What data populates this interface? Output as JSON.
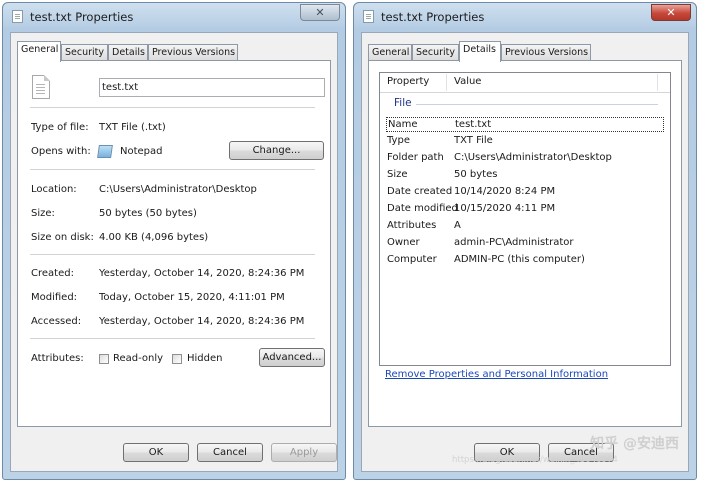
{
  "left": {
    "title": "test.txt Properties",
    "tabs": [
      "General",
      "Security",
      "Details",
      "Previous Versions"
    ],
    "file_name": "test.txt",
    "type_label": "Type of file:",
    "type_value": "TXT File (.txt)",
    "opens_label": "Opens with:",
    "opens_value": "Notepad",
    "change_button": "Change...",
    "location_label": "Location:",
    "location_value": "C:\\Users\\Administrator\\Desktop",
    "size_label": "Size:",
    "size_value": "50 bytes (50 bytes)",
    "size_disk_label": "Size on disk:",
    "size_disk_value": "4.00 KB (4,096 bytes)",
    "created_label": "Created:",
    "created_value": "Yesterday, October 14, 2020, 8:24:36 PM",
    "modified_label": "Modified:",
    "modified_value": "Today, October 15, 2020, 4:11:01 PM",
    "accessed_label": "Accessed:",
    "accessed_value": "Yesterday, October 14, 2020, 8:24:36 PM",
    "attributes_label": "Attributes:",
    "readonly_label": "Read-only",
    "hidden_label": "Hidden",
    "advanced_button": "Advanced...",
    "ok_button": "OK",
    "cancel_button": "Cancel",
    "apply_button": "Apply"
  },
  "right": {
    "title": "test.txt Properties",
    "tabs": [
      "General",
      "Security",
      "Details",
      "Previous Versions"
    ],
    "col_property": "Property",
    "col_value": "Value",
    "group": "File",
    "rows": [
      {
        "p": "Name",
        "v": "test.txt"
      },
      {
        "p": "Type",
        "v": "TXT File"
      },
      {
        "p": "Folder path",
        "v": "C:\\Users\\Administrator\\Desktop"
      },
      {
        "p": "Size",
        "v": "50 bytes"
      },
      {
        "p": "Date created",
        "v": "10/14/2020 8:24 PM"
      },
      {
        "p": "Date modified",
        "v": "10/15/2020 4:11 PM"
      },
      {
        "p": "Attributes",
        "v": "A"
      },
      {
        "p": "Owner",
        "v": "admin-PC\\Administrator"
      },
      {
        "p": "Computer",
        "v": "ADMIN-PC (this computer)"
      }
    ],
    "remove_link": "Remove Properties and Personal Information",
    "ok_button": "OK",
    "cancel_button": "Cancel",
    "watermark": "知乎 @安迪西",
    "watermark_url": "https://blog.csdn.net/weixin_45046974"
  }
}
